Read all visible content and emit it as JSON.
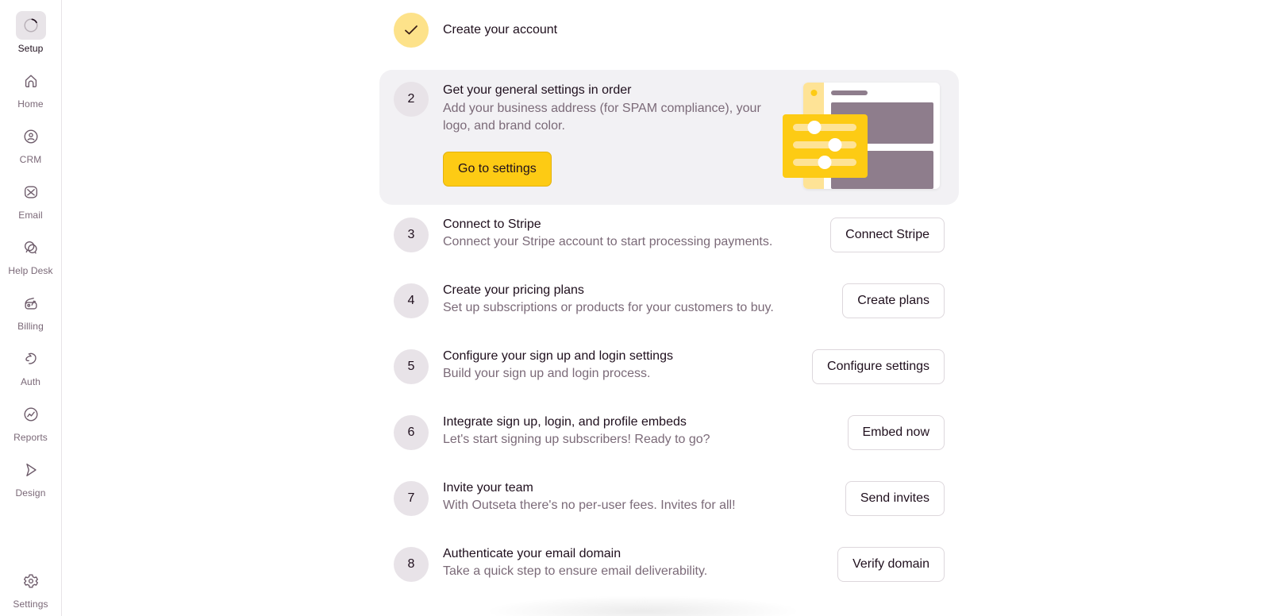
{
  "sidebar": {
    "items": [
      {
        "id": "setup",
        "label": "Setup",
        "icon": "loading-spinner-icon",
        "active": true
      },
      {
        "id": "home",
        "label": "Home",
        "icon": "home-icon"
      },
      {
        "id": "crm",
        "label": "CRM",
        "icon": "user-circle-icon"
      },
      {
        "id": "email",
        "label": "Email",
        "icon": "envelope-icon"
      },
      {
        "id": "help-desk",
        "label": "Help Desk",
        "icon": "chat-bubbles-icon"
      },
      {
        "id": "billing",
        "label": "Billing",
        "icon": "wallet-icon"
      },
      {
        "id": "auth",
        "label": "Auth",
        "icon": "auth-swirl-icon"
      },
      {
        "id": "reports",
        "label": "Reports",
        "icon": "chart-circle-icon"
      },
      {
        "id": "design",
        "label": "Design",
        "icon": "cursor-arrow-icon"
      },
      {
        "id": "settings",
        "label": "Settings",
        "icon": "gear-icon"
      }
    ]
  },
  "colors": {
    "accent": "#fdcb14",
    "done_circle": "#fde28a",
    "step_circle": "#e8e3e8",
    "card_bg": "#f2f1f4",
    "text_primary": "#1f0f1d",
    "text_secondary": "#7b6a78"
  },
  "steps": [
    {
      "number": "",
      "status": "done",
      "icon": "checkmark-icon",
      "title": "Create your account"
    },
    {
      "number": "2",
      "status": "current",
      "title": "Get your general settings in order",
      "description_line1": "Add your business address (for SPAM compliance), your",
      "description_line2": "logo, and brand color.",
      "button": "Go to settings",
      "illustration": "settings-sliders-illustration"
    },
    {
      "number": "3",
      "title": "Connect to Stripe",
      "description": "Connect your Stripe account to start processing payments.",
      "button": "Connect Stripe"
    },
    {
      "number": "4",
      "title": "Create your pricing plans",
      "description": "Set up subscriptions or products for your customers to buy.",
      "button": "Create plans"
    },
    {
      "number": "5",
      "title": "Configure your sign up and login settings",
      "description": "Build your sign up and login process.",
      "button": "Configure settings"
    },
    {
      "number": "6",
      "title": "Integrate sign up, login, and profile embeds",
      "description": "Let's start signing up subscribers! Ready to go?",
      "button": "Embed now"
    },
    {
      "number": "7",
      "title": "Invite your team",
      "description": "With Outseta there's no per-user fees. Invites for all!",
      "button": "Send invites"
    },
    {
      "number": "8",
      "title": "Authenticate your email domain",
      "description": "Take a quick step to ensure email deliverability.",
      "button": "Verify domain"
    }
  ]
}
